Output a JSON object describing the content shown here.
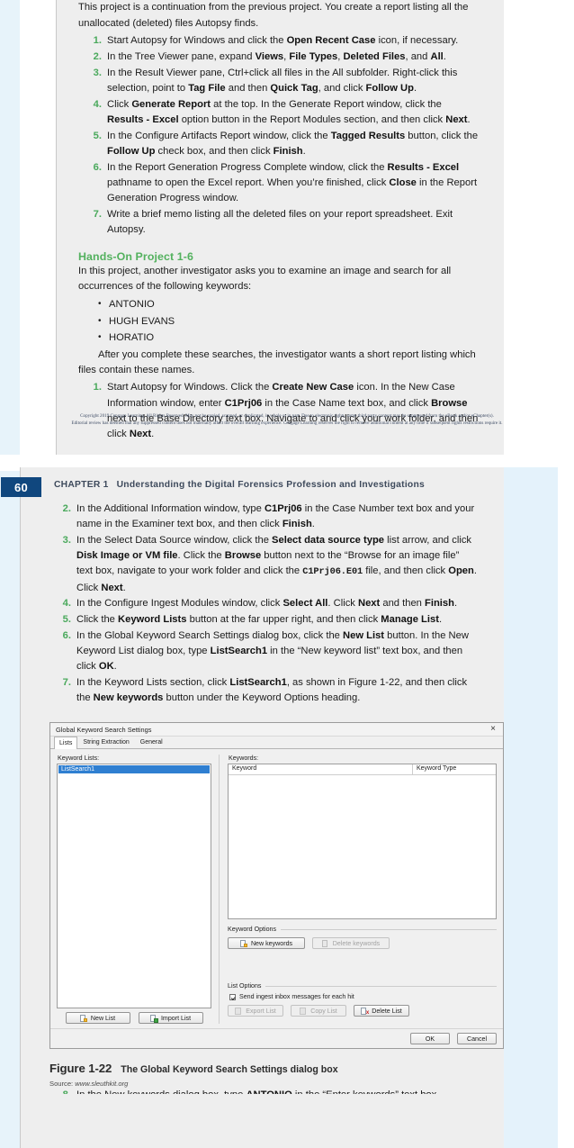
{
  "page1": {
    "intro_lines": [
      "This project is a continuation from the previous project. You create a report listing all the",
      "unallocated (deleted) files Autopsy finds."
    ],
    "steps": [
      {
        "num": "1.",
        "html": "Start Autopsy for Windows and click the <b>Open Recent Case</b> icon, if necessary."
      },
      {
        "num": "2.",
        "html": "In the Tree Viewer pane, expand <b>Views</b>, <b>File Types</b>, <b>Deleted Files</b>, and <b>All</b>."
      },
      {
        "num": "3.",
        "html": "In the Result Viewer pane, Ctrl+click all files in the All subfolder. Right-click this selection, point to <b>Tag File</b> and then <b>Quick Tag</b>, and click <b>Follow Up</b>."
      },
      {
        "num": "4.",
        "html": "Click <b>Generate Report</b> at the top. In the Generate Report window, click the <b>Results&nbsp;-&nbsp;Excel</b> option button in the Report Modules section, and then click <b>Next</b>."
      },
      {
        "num": "5.",
        "html": "In the Configure Artifacts Report window, click the <b>Tagged Results</b> button, click the <b>Follow Up</b> check box, and then click <b>Finish</b>."
      },
      {
        "num": "6.",
        "html": "In the Report Generation Progress Complete window, click the <b>Results - Excel</b> pathname to open the Excel report. When you&rsquo;re finished, click <b>Close</b> in the Report Generation Progress window."
      },
      {
        "num": "7.",
        "html": "Write a brief memo listing all the deleted files on your report spreadsheet. Exit Autopsy."
      }
    ],
    "project_heading": "Hands-On Project 1-6",
    "project_intro": "In this project, another investigator asks you to examine an image and search for all occurrences of the following keywords:",
    "keywords": [
      "ANTONIO",
      "HUGH EVANS",
      "HORATIO"
    ],
    "after_para": "After you complete these searches, the investigator wants a short report listing which files contain these names.",
    "project_steps": [
      {
        "num": "1.",
        "html": "Start Autopsy for Windows. Click the <b>Create New Case</b> icon. In the New Case Information window, enter <b>C1Prj06</b> in the Case Name text box, and click <b>Browse</b> next to the Base Directory text box. Navigate to and click your work folder, and then click <b>Next</b>."
      }
    ]
  },
  "copyright": [
    "Copyright 2019 Cengage Learning. All Rights Reserved. May not be copied, scanned, or duplicated, in whole or in part. Due to electronic rights, some third party content may be suppressed from the eBook and/or eChapter(s).",
    "Editorial review has deemed that any suppressed content does not materially affect the overall learning experience. Cengage Learning reserves the right to remove additional content at any time if subsequent rights restrictions require it."
  ],
  "page2": {
    "page_number": "60",
    "chapter_label": "CHAPTER 1",
    "chapter_title": "Understanding the Digital Forensics Profession and Investigations",
    "steps": [
      {
        "num": "2.",
        "html": "In the Additional Information window, type <b>C1Prj06</b> in the Case Number text box and your name in the Examiner text box, and then click <b>Finish</b>."
      },
      {
        "num": "3.",
        "html": "In the Select Data Source window, click the <b>Select data source type</b> list arrow, and click <b>Disk Image or VM file</b>. Click the <b>Browse</b> button next to the &ldquo;Browse for an image file&rdquo; text box, navigate to your work folder and click the <code>C1Prj06.E01</code> file, and then click <b>Open</b>. Click <b>Next</b>."
      },
      {
        "num": "4.",
        "html": "In the Configure Ingest Modules window, click <b>Select All</b>. Click <b>Next</b> and then <b>Finish</b>."
      },
      {
        "num": "5.",
        "html": "Click the <b>Keyword Lists</b> button at the far upper right, and then click <b>Manage List</b>."
      },
      {
        "num": "6.",
        "html": "In the Global Keyword Search Settings dialog box, click the <b>New List</b> button. In the New Keyword List dialog box, type <b>ListSearch1</b> in the &ldquo;New keyword list&rdquo; text box, and then click <b>OK</b>."
      },
      {
        "num": "7.",
        "html": "In the Keyword Lists section, click <b>ListSearch1</b>, as shown in Figure 1-22, and then click the <b>New keywords</b> button under the Keyword Options heading."
      }
    ],
    "cutoff_step": {
      "num": "8.",
      "html": "In the New keywords dialog box, type <b>ANTONIO</b> in the &ldquo;Enter keywords&rdquo; text box"
    }
  },
  "dialog": {
    "title": "Global Keyword Search Settings",
    "close_icon": "×",
    "tabs": [
      {
        "label": "Lists",
        "active": true
      },
      {
        "label": "String Extraction",
        "active": false
      },
      {
        "label": "General",
        "active": false
      }
    ],
    "keyword_lists_label": "Keyword Lists:",
    "selected_list": "ListSearch1",
    "list_buttons": [
      {
        "label": "New List",
        "enabled": true,
        "icon": "new-list-icon"
      },
      {
        "label": "Import List",
        "enabled": true,
        "icon": "import-list-icon"
      }
    ],
    "keywords_label": "Keywords:",
    "table_headers": [
      "Keyword",
      "Keyword Type"
    ],
    "table_rows": [],
    "keyword_options_label": "Keyword Options",
    "keyword_option_buttons": [
      {
        "label": "New keywords",
        "enabled": true,
        "icon": "new-keywords-icon"
      },
      {
        "label": "Delete keywords",
        "enabled": false,
        "icon": "delete-keywords-icon"
      }
    ],
    "list_options_label": "List Options",
    "checkbox_label": "Send ingest inbox messages for each hit",
    "checkbox_checked": true,
    "list_option_buttons": [
      {
        "label": "Export List",
        "enabled": false,
        "icon": "export-list-icon"
      },
      {
        "label": "Copy List",
        "enabled": false,
        "icon": "copy-list-icon"
      },
      {
        "label": "Delete List",
        "enabled": true,
        "icon": "delete-list-icon"
      }
    ],
    "footer_buttons": [
      {
        "label": "OK"
      },
      {
        "label": "Cancel"
      }
    ]
  },
  "figure": {
    "number": "Figure 1-22",
    "title": "The Global Keyword Search Settings dialog box",
    "source_prefix": "Source: ",
    "source_url": "www.sleuthkit.org"
  },
  "colors": {
    "accent_green": "#53b15e",
    "page_badge_blue": "#10477e",
    "selection_blue": "#2f7fd1",
    "page_bg": "#eeeeee"
  }
}
